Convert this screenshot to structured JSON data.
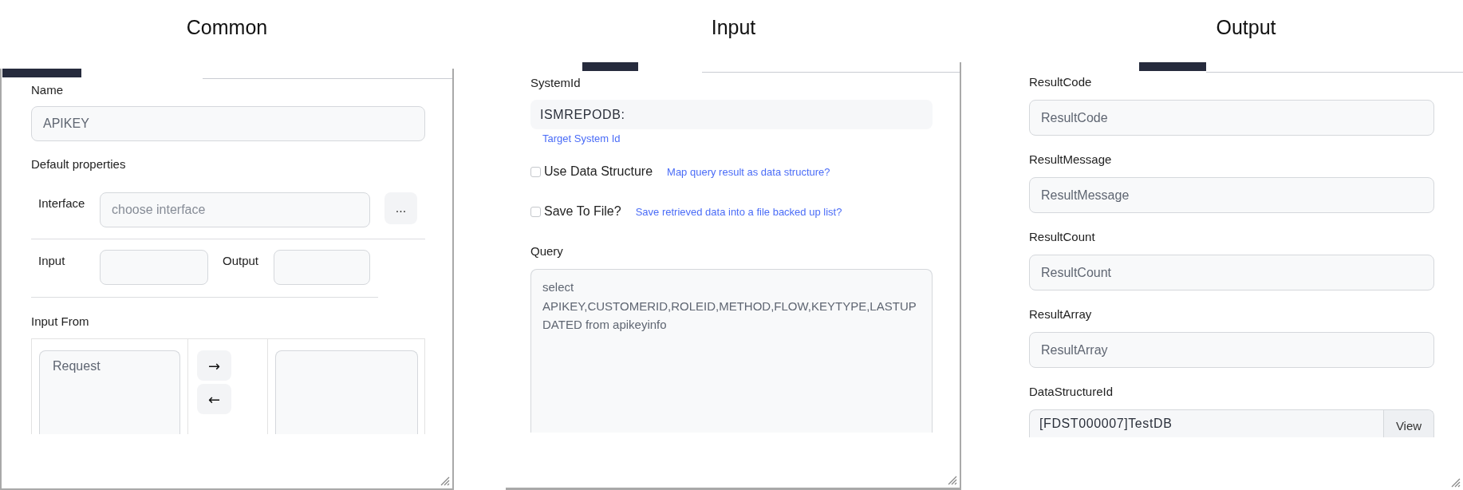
{
  "common": {
    "title": "Common",
    "name": {
      "label": "Name",
      "value": "APIKEY"
    },
    "section_label": "Default properties",
    "interface": {
      "label": "Interface",
      "placeholder": "choose interface",
      "button": "..."
    },
    "input": {
      "label": "Input"
    },
    "output": {
      "label": "Output"
    },
    "input_from": {
      "label": "Input From",
      "left_items": [
        "Request"
      ],
      "arrows": [
        "→",
        "←"
      ]
    }
  },
  "input": {
    "title": "Input",
    "system_id": {
      "label": "SystemId",
      "value": "ISMREPODB:",
      "hint": "Target System Id"
    },
    "options": [
      {
        "label": "Use Data Structure",
        "hint": "Map query result as data structure?",
        "checked": false
      },
      {
        "label": "Save To File?",
        "hint": "Save retrieved data into a file backed up list?",
        "checked": false
      }
    ],
    "query": {
      "label": "Query",
      "value": "select APIKEY,CUSTOMERID,ROLEID,METHOD,FLOW,KEYTYPE,LASTUPDATED from apikeyinfo"
    }
  },
  "output": {
    "title": "Output",
    "fields": [
      {
        "kind": "text",
        "label": "ResultCode",
        "placeholder": "ResultCode"
      },
      {
        "kind": "text",
        "label": "ResultMessage",
        "placeholder": "ResultMessage"
      },
      {
        "kind": "text",
        "label": "ResultCount",
        "placeholder": "ResultCount"
      },
      {
        "kind": "text",
        "label": "ResultArray",
        "placeholder": "ResultArray"
      },
      {
        "kind": "lookup",
        "label": "DataStructureId",
        "value": "[FDST000007]TestDB",
        "button": "View"
      }
    ]
  }
}
